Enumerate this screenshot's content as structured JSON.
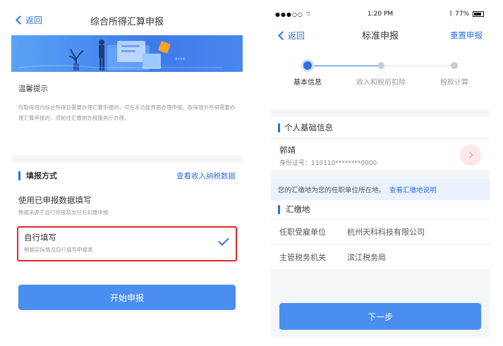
{
  "left": {
    "nav": {
      "back_label": "返回",
      "title": "综合所得汇算申报"
    },
    "tips": {
      "title": "温馨提示",
      "body": "仅取得境内综合所得且需要办理汇算申报的，可在本功能界面办理申报。取得境外所得需要办理汇算申报的，须前往汇缴地办税服务厅办理。"
    },
    "method": {
      "section_title": "填报方式",
      "link_label": "查看收入纳税数据",
      "option1_title": "使用已申报数据填写",
      "option1_sub": "数据来源于自行申报及支付方扣缴申报",
      "option2_title": "自行填写",
      "option2_sub": "根据实际情况自行填写申报表",
      "start_button": "开始申报"
    }
  },
  "right": {
    "status": {
      "signal": "●●●○○",
      "time": "1:20 PM",
      "battery": "77%"
    },
    "nav": {
      "back_label": "返回",
      "title": "标准申报",
      "action_label": "重置申报"
    },
    "steps": [
      "基本信息",
      "收入和税前扣除",
      "税款计算"
    ],
    "personal_section_title": "个人基础信息",
    "person": {
      "name": "郭靖",
      "id_label": "身份证号：",
      "id_value": "110110********0000"
    },
    "notice_text": "您的汇缴地为您的任职单位所在地。",
    "notice_link": "查看汇缴地说明",
    "remit_section_title": "汇缴地",
    "rows": [
      {
        "key": "任职受雇单位",
        "value": "杭州天科科技有限公司"
      },
      {
        "key": "主管税务机关",
        "value": "滨江税务局"
      }
    ],
    "next_button": "下一步"
  }
}
